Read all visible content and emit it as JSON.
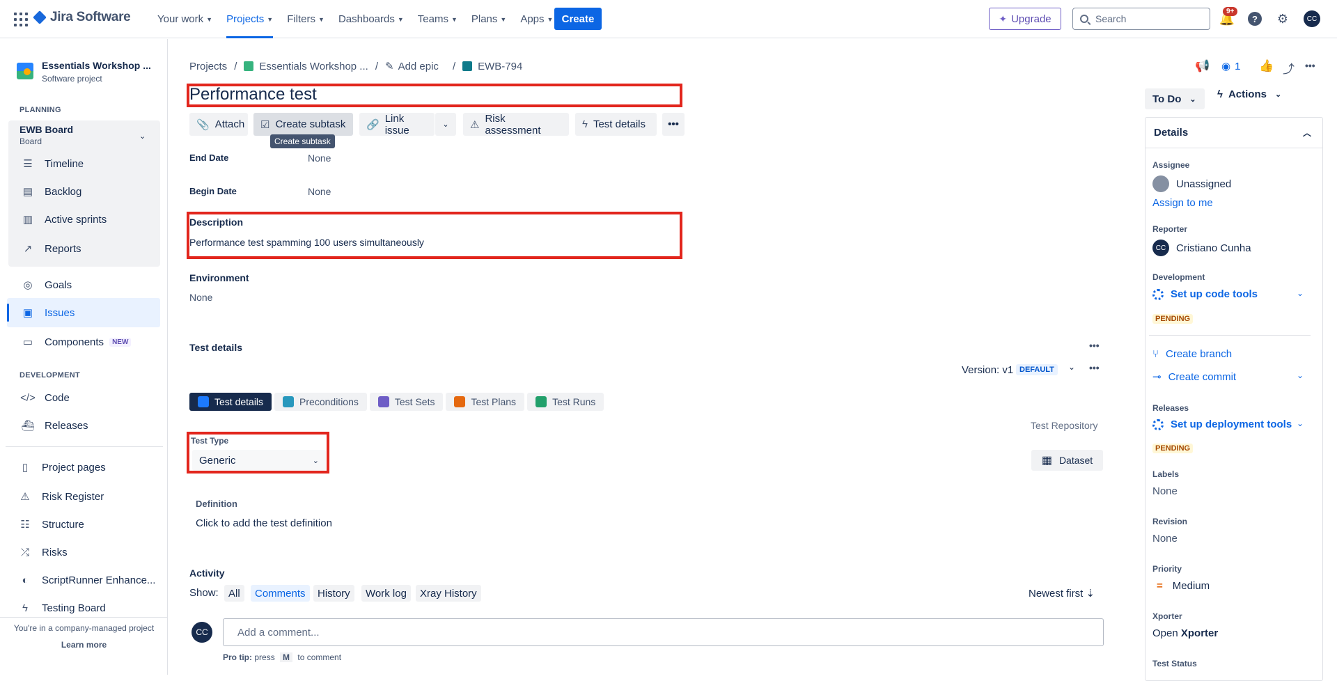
{
  "topbar": {
    "brand": "Jira Software",
    "nav": [
      {
        "label": "Your work"
      },
      {
        "label": "Projects"
      },
      {
        "label": "Filters"
      },
      {
        "label": "Dashboards"
      },
      {
        "label": "Teams"
      },
      {
        "label": "Plans"
      },
      {
        "label": "Apps"
      }
    ],
    "create_label": "Create",
    "upgrade_label": "Upgrade",
    "search_placeholder": "Search",
    "notifications_badge": "9+",
    "avatar_initials": "CC"
  },
  "sidebar": {
    "project_name": "Essentials Workshop ...",
    "project_type": "Software project",
    "planning_title": "PLANNING",
    "board_name": "EWB Board",
    "board_sub": "Board",
    "planning_items": [
      "Timeline",
      "Backlog",
      "Active sprints",
      "Reports"
    ],
    "goals": "Goals",
    "issues": "Issues",
    "components": "Components",
    "new_tag": "NEW",
    "development_title": "DEVELOPMENT",
    "code": "Code",
    "releases": "Releases",
    "extra_items": [
      "Project pages",
      "Risk Register",
      "Structure",
      "Risks",
      "ScriptRunner Enhance...",
      "Testing Board"
    ],
    "footer_text": "You're in a company-managed project",
    "learn_more": "Learn more"
  },
  "breadcrumb": {
    "projects": "Projects",
    "project": "Essentials Workshop ...",
    "add_epic": "Add epic",
    "issue_key": "EWB-794"
  },
  "issue": {
    "title": "Performance test",
    "toolbar": {
      "attach": "Attach",
      "create_subtask": "Create subtask",
      "link_issue": "Link issue",
      "risk_assessment": "Risk assessment",
      "test_details": "Test details"
    },
    "tooltip": "Create subtask",
    "end_date_label": "End Date",
    "end_date_value": "None",
    "begin_date_label": "Begin Date",
    "begin_date_value": "None",
    "description_label": "Description",
    "description_text": "Performance test spamming 100 users simultaneously",
    "environment_label": "Environment",
    "environment_value": "None",
    "test_details_heading": "Test details",
    "version_label": "Version: v1",
    "version_badge": "DEFAULT",
    "tabs": [
      "Test details",
      "Preconditions",
      "Test Sets",
      "Test Plans",
      "Test Runs"
    ],
    "test_repository": "Test Repository",
    "test_type_label": "Test Type",
    "test_type_value": "Generic",
    "dataset_label": "Dataset",
    "definition_label": "Definition",
    "definition_placeholder": "Click to add the test definition",
    "activity_heading": "Activity",
    "show_label": "Show:",
    "activity_tabs": [
      "All",
      "Comments",
      "History",
      "Work log",
      "Xray History"
    ],
    "sort_label": "Newest first",
    "comment_placeholder": "Add a comment...",
    "pro_tip_prefix": "Pro tip:",
    "pro_tip_press": "press",
    "pro_tip_key": "M",
    "pro_tip_suffix": "to comment"
  },
  "right": {
    "watchers_count": "1",
    "status": "To Do",
    "actions": "Actions",
    "details_title": "Details",
    "assignee_label": "Assignee",
    "assignee_value": "Unassigned",
    "assign_to_me": "Assign to me",
    "reporter_label": "Reporter",
    "reporter_value": "Cristiano Cunha",
    "reporter_initials": "CC",
    "development_label": "Development",
    "setup_code_tools": "Set up code tools",
    "pending": "PENDING",
    "create_branch": "Create branch",
    "create_commit": "Create commit",
    "releases_label": "Releases",
    "setup_deploy": "Set up deployment tools",
    "labels_label": "Labels",
    "labels_value": "None",
    "revision_label": "Revision",
    "revision_value": "None",
    "priority_label": "Priority",
    "priority_value": "Medium",
    "xporter_label": "Xporter",
    "xporter_open": "Open",
    "xporter_name": "Xporter",
    "test_status_label": "Test Status"
  },
  "colors": {
    "accent": "#0c66e4",
    "highlight": "#e2261d",
    "pending": "#a54800"
  }
}
